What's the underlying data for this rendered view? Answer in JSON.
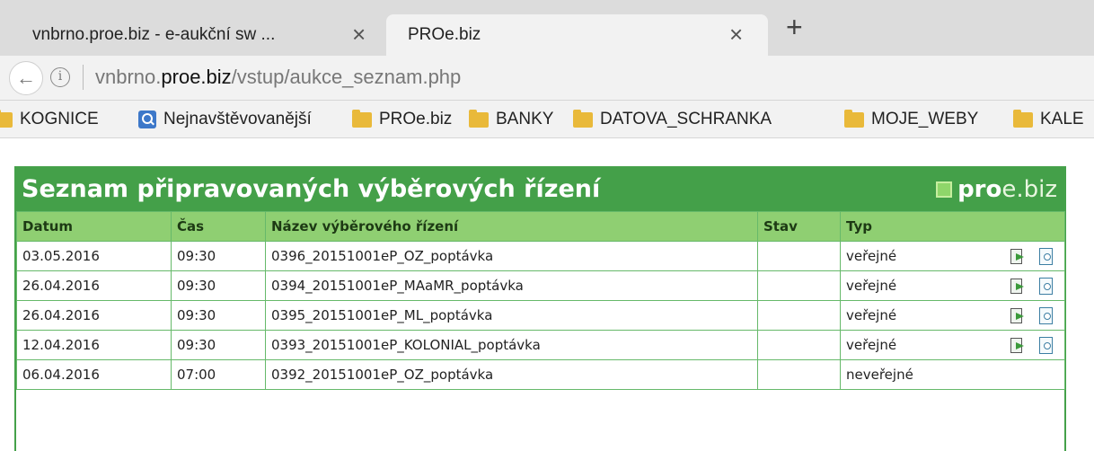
{
  "browser": {
    "tabs": [
      {
        "label": "vnbrno.proe.biz - e-aukční sw ...",
        "close": "×"
      },
      {
        "label": "PROe.biz",
        "close": "×"
      }
    ],
    "new_tab": "+",
    "address": {
      "back": "←",
      "info": "i",
      "url_prefix": "vnbrno.",
      "url_domain": "proe.biz",
      "url_path": "/vstup/aukce_seznam.php"
    },
    "bookmarks": [
      {
        "label": "KOGNICE",
        "icon": "folder-icon"
      },
      {
        "label": "Nejnavštěvovanější",
        "icon": "search-icon"
      },
      {
        "label": "PROe.biz",
        "icon": "folder-icon"
      },
      {
        "label": "BANKY",
        "icon": "folder-icon"
      },
      {
        "label": "DATOVA_SCHRANKA",
        "icon": "folder-icon"
      },
      {
        "label": "MOJE_WEBY",
        "icon": "folder-icon"
      },
      {
        "label": "KALE",
        "icon": "folder-icon"
      }
    ]
  },
  "page": {
    "title": "Seznam připravovaných výběrových řízení",
    "logo": {
      "bold": "pro",
      "rest": "e.biz"
    },
    "columns": [
      "Datum",
      "Čas",
      "Název výběrového řízení",
      "Stav",
      "Typ"
    ],
    "rows": [
      {
        "date": "03.05.2016",
        "time": "09:30",
        "name": "0396_20151001eP_OZ_poptávka",
        "stav": "",
        "typ": "veřejné",
        "actions": true
      },
      {
        "date": "26.04.2016",
        "time": "09:30",
        "name": "0394_20151001eP_MAaMR_poptávka",
        "stav": "",
        "typ": "veřejné",
        "actions": true
      },
      {
        "date": "26.04.2016",
        "time": "09:30",
        "name": "0395_20151001eP_ML_poptávka",
        "stav": "",
        "typ": "veřejné",
        "actions": true
      },
      {
        "date": "12.04.2016",
        "time": "09:30",
        "name": "0393_20151001eP_KOLONIAL_poptávka",
        "stav": "",
        "typ": "veřejné",
        "actions": true
      },
      {
        "date": "06.04.2016",
        "time": "07:00",
        "name": "0392_20151001eP_OZ_poptávka",
        "stav": "",
        "typ": "neveřejné",
        "actions": false
      }
    ],
    "colors": {
      "header_green": "#44a049",
      "column_header_green": "#8fcf72",
      "border_green": "#66b96a"
    }
  }
}
